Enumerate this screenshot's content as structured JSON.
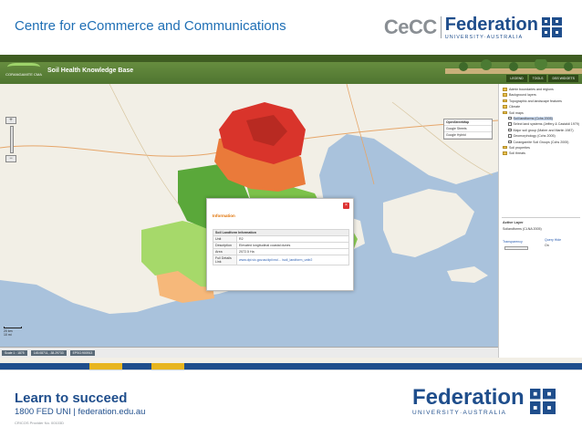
{
  "slide": {
    "title": "Centre for eCommerce and Communications",
    "logo_cecc": "CeCC",
    "logo_federation": "Federation",
    "logo_university": "UNIVERSITY·AUSTRALIA"
  },
  "app": {
    "logo_text": "CORANGAMITE CMA",
    "title": "Soil Health Knowledge Base",
    "nav": [
      "LEGEND",
      "TOOLS",
      "DSS WIDGETS"
    ]
  },
  "map": {
    "zoom_in": "+",
    "zoom_out": "−",
    "base_layers": [
      {
        "label": "OpenStreetMap",
        "selected": true
      },
      {
        "label": "Google Streets",
        "selected": false
      },
      {
        "label": "Google Hybrid",
        "selected": false
      }
    ],
    "scale_labels": [
      "20 km",
      "10 mi"
    ],
    "attribution": "© OpenStreetMap contributors",
    "status": [
      "Scale 1 : 1875",
      "145.08711, -38.29733",
      "EPSG:900913"
    ],
    "colors": {
      "sea": "#a9c2dc",
      "land": "#f2efe6",
      "soil_red": "#d9342b",
      "soil_orange": "#ea7a3a",
      "soil_green_dark": "#5aa83a",
      "soil_green_light": "#a6d96a",
      "soil_peach": "#f6b87a"
    }
  },
  "popup": {
    "title": "Information",
    "close": "×",
    "table_header": "Soil Landform Information",
    "rows": [
      {
        "key": "Unit",
        "value": "R2"
      },
      {
        "key": "Description",
        "value": "Elevated longitudinal coastal dunes"
      },
      {
        "key": "Area",
        "value": "2072.5 Ha"
      },
      {
        "key": "Full Details Link",
        "value": "www.dpi.vic.gov.au/dpi/vro/... /soil_landform_unitr2"
      }
    ]
  },
  "sidebar": {
    "tree": [
      {
        "label": "Admin boundaries and regions",
        "type": "folder",
        "level": 0,
        "selected": false
      },
      {
        "label": "Background layers",
        "type": "folder",
        "level": 0,
        "selected": false
      },
      {
        "label": "Topographic and landscape features",
        "type": "folder",
        "level": 0,
        "selected": false
      },
      {
        "label": "Climate",
        "type": "folder",
        "level": 0,
        "selected": false
      },
      {
        "label": "Soil maps",
        "type": "folder",
        "level": 0,
        "selected": false
      },
      {
        "label": "Soil landforms (Cchs 2005)",
        "type": "check",
        "level": 1,
        "selected": true
      },
      {
        "label": "Select land systems (Jeffery & Castaldi 1979)",
        "type": "check",
        "level": 1,
        "selected": false
      },
      {
        "label": "Major soil group (Maher and Martin 1987)",
        "type": "check",
        "level": 1,
        "selected": false
      },
      {
        "label": "Geomorphology (Cchs 2005)",
        "type": "check",
        "level": 1,
        "selected": false
      },
      {
        "label": "Corangamite Soil Groups (Cchs 2005)",
        "type": "check",
        "level": 1,
        "selected": false
      },
      {
        "label": "Soil properties",
        "type": "folder",
        "level": 0,
        "selected": false
      },
      {
        "label": "Soil threats",
        "type": "folder",
        "level": 0,
        "selected": false
      }
    ],
    "active_layer_heading": "Active Layer",
    "active_layer_value": "Soilandforms (CLNA 2005)",
    "transparency_label": "Transparency",
    "query_label": "Query Hide",
    "query_value": "On"
  },
  "footer": {
    "learn": "Learn to succeed",
    "contact": "1800 FED UNI | federation.edu.au",
    "cricos": "CRICOS Provider No. 00103D",
    "logo_federation": "Federation",
    "logo_university": "UNIVERSITY·AUSTRALIA",
    "band_colors": [
      "#1f4e8c",
      "#e8b51e",
      "#1f4e8c",
      "#e8b51e",
      "#1f4e8c"
    ]
  }
}
